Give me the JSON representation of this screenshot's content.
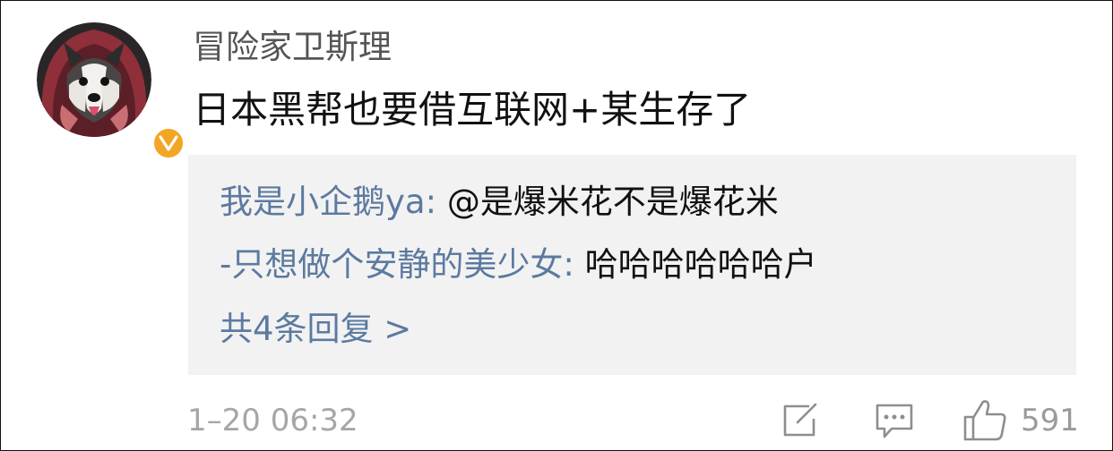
{
  "comment": {
    "username": "冒险家卫斯理",
    "text": "日本黑帮也要借互联网+某生存了",
    "verified_badge": "V",
    "avatar": "husky-dog-in-red-hood-avatar",
    "colors": {
      "username": "#555555",
      "text": "#111111",
      "link": "#5c7aa0",
      "badge": "#f3a623",
      "reply_bg": "#f2f2f2",
      "meta": "#a6a6a6"
    }
  },
  "replies": [
    {
      "author": "我是小企鹅ya:",
      "content": "@是爆米花不是爆花米"
    },
    {
      "author": "-只想做个安静的美少女:",
      "content": "哈哈哈哈哈哈户"
    }
  ],
  "replies_more": "共4条回复 >",
  "footer": {
    "time": "1–20 06:32",
    "share_icon": "share-edit-icon",
    "comment_icon": "comment-bubble-icon",
    "like_icon": "thumbs-up-icon",
    "like_count": "591"
  }
}
